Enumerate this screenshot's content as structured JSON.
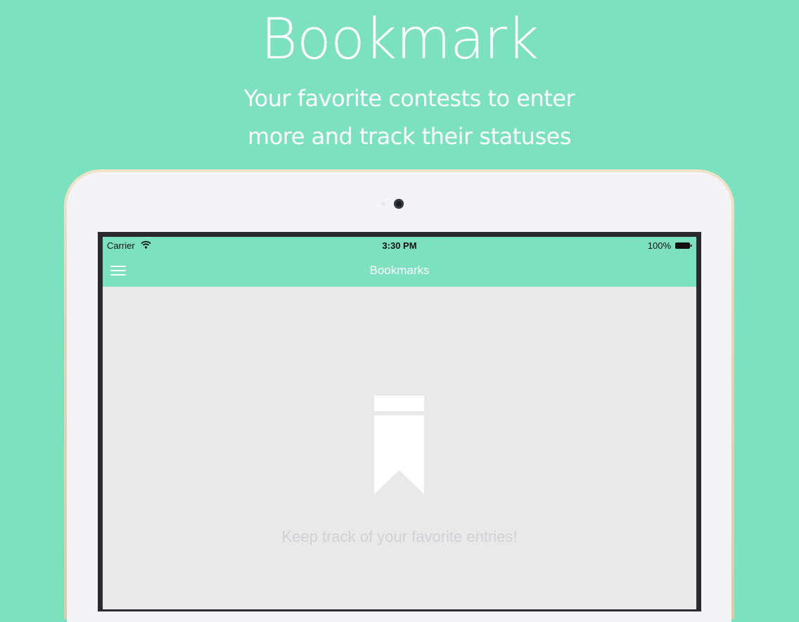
{
  "promo": {
    "title": "Bookmark",
    "subtitle_line1": "Your favorite contests to enter",
    "subtitle_line2": "more and track their statuses"
  },
  "status_bar": {
    "carrier": "Carrier",
    "time": "3:30 PM",
    "battery": "100%",
    "icons": [
      "wifi-icon",
      "battery-icon"
    ]
  },
  "nav": {
    "title": "Bookmarks",
    "menu_icon": "hamburger-menu-icon"
  },
  "empty_state": {
    "icon": "bookmark-icon",
    "message": "Keep track of your favorite entries!"
  },
  "colors": {
    "brand_mint": "#7be1bf",
    "screen_background": "#e9e9ea",
    "empty_text": "#d2d2d4"
  }
}
